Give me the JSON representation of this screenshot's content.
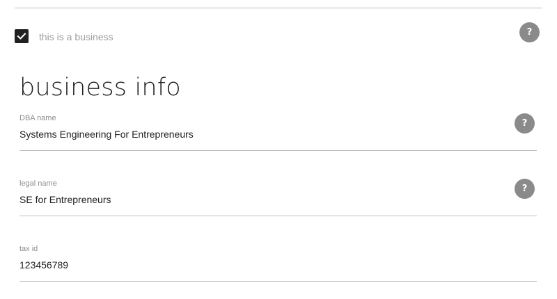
{
  "business_toggle": {
    "checked": true,
    "label": "this is a business",
    "help_glyph": "?"
  },
  "section": {
    "title": "business info"
  },
  "fields": {
    "dba_name": {
      "label": "DBA name",
      "value": "Systems Engineering For Entrepreneurs",
      "help_glyph": "?"
    },
    "legal_name": {
      "label": "legal name",
      "value": "SE for Entrepreneurs",
      "help_glyph": "?"
    },
    "tax_id": {
      "label": "tax id",
      "value": "123456789"
    }
  },
  "icons": {
    "checkbox": "check-icon",
    "help": "help-icon"
  },
  "colors": {
    "checkbox_fill": "#212121",
    "help_button": "#8a8a8a",
    "label_text": "#9e9e9e",
    "divider": "#bdbdbd"
  }
}
